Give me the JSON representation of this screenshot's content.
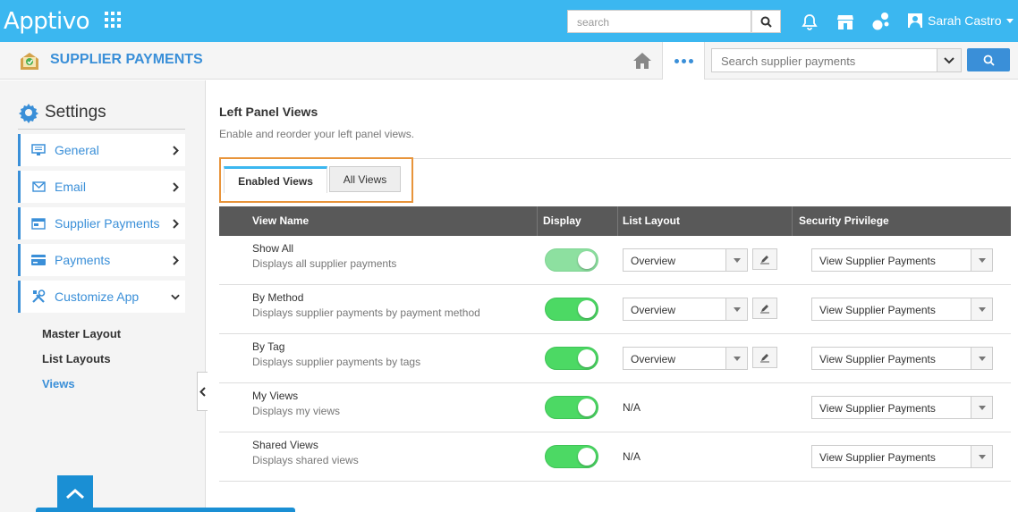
{
  "topbar": {
    "logo": "Apptivo",
    "search_placeholder": "search",
    "user_name": "Sarah Castro"
  },
  "app": {
    "title": "SUPPLIER PAYMENTS",
    "search_placeholder": "Search supplier payments"
  },
  "sidebar": {
    "title": "Settings",
    "items": [
      {
        "label": "General",
        "icon": "monitor-icon"
      },
      {
        "label": "Email",
        "icon": "envelope-icon"
      },
      {
        "label": "Supplier Payments",
        "icon": "payments-card-icon"
      },
      {
        "label": "Payments",
        "icon": "credit-card-icon"
      },
      {
        "label": "Customize App",
        "icon": "tools-icon"
      }
    ],
    "subitems": [
      "Master Layout",
      "List Layouts",
      "Views"
    ]
  },
  "main": {
    "title": "Left Panel Views",
    "subtitle": "Enable and reorder your left panel views.",
    "tabs": [
      "Enabled Views",
      "All Views"
    ],
    "columns": [
      "View Name",
      "Display",
      "List Layout",
      "Security Privilege"
    ],
    "rows": [
      {
        "name": "Show All",
        "desc": "Displays all supplier payments",
        "layout": "Overview",
        "privilege": "View Supplier Payments"
      },
      {
        "name": "By Method",
        "desc": "Displays supplier payments by payment method",
        "layout": "Overview",
        "privilege": "View Supplier Payments"
      },
      {
        "name": "By Tag",
        "desc": "Displays supplier payments by tags",
        "layout": "Overview",
        "privilege": "View Supplier Payments"
      },
      {
        "name": "My Views",
        "desc": "Displays my views",
        "layout": "N/A",
        "privilege": "View Supplier Payments"
      },
      {
        "name": "Shared Views",
        "desc": "Displays shared views",
        "layout": "N/A",
        "privilege": "View Supplier Payments"
      }
    ]
  },
  "colors": {
    "topbar": "#3bb7f0",
    "accent": "#3a8fd8",
    "toggle_on": "#4cd964",
    "highlight": "#e8943a"
  }
}
